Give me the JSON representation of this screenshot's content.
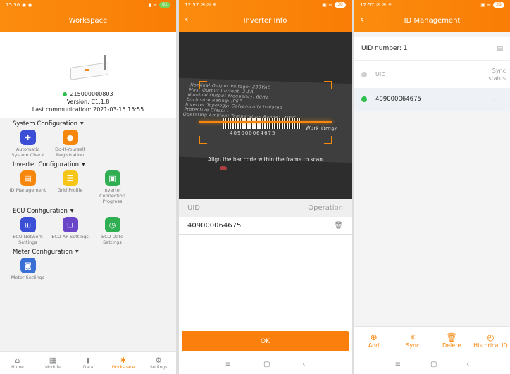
{
  "colors": {
    "accent": "#f7860c",
    "online": "#2fbf4e",
    "offline": "#cfcfcf"
  },
  "workspace": {
    "status": {
      "time": "15:56",
      "battery": "81"
    },
    "title": "Workspace",
    "device": {
      "id": "215000000803",
      "version": "Version: C1.1.8",
      "last_comm": "Last communication: 2021-03-15 15:55"
    },
    "sections": [
      {
        "title": "System Configuration",
        "items": [
          {
            "label": "Automatic System Check",
            "icon": "medkit-icon",
            "color": "#3a4ed6"
          },
          {
            "label": "Do-It-Yourself Registration",
            "icon": "person-icon",
            "color": "#f7860c"
          }
        ]
      },
      {
        "title": "Inverter Configuration",
        "items": [
          {
            "label": "ID Management",
            "icon": "id-card-icon",
            "color": "#f7860c"
          },
          {
            "label": "Grid Profile",
            "icon": "sliders-icon",
            "color": "#f5c518"
          },
          {
            "label": "Inverter Connection Progress",
            "icon": "inverter-icon",
            "color": "#2fae52"
          }
        ]
      },
      {
        "title": "ECU Configuration",
        "items": [
          {
            "label": "ECU Network Settings",
            "icon": "network-icon",
            "color": "#3a4ed6"
          },
          {
            "label": "ECU AP Settings",
            "icon": "ap-icon",
            "color": "#6a47c9"
          },
          {
            "label": "ECU Date Settings",
            "icon": "clock-icon",
            "color": "#2fae52"
          }
        ]
      },
      {
        "title": "Meter Configuration",
        "items": [
          {
            "label": "Meter Settings",
            "icon": "meter-icon",
            "color": "#3a6fd6"
          }
        ]
      }
    ],
    "tabs": [
      {
        "label": "Home",
        "icon": "home-icon"
      },
      {
        "label": "Module",
        "icon": "grid-icon"
      },
      {
        "label": "Data",
        "icon": "chart-icon"
      },
      {
        "label": "Workspace",
        "icon": "workspace-icon",
        "active": true
      },
      {
        "label": "Settings",
        "icon": "gear-icon"
      }
    ]
  },
  "inverter_info": {
    "status": {
      "time": "12:57",
      "battery": "38"
    },
    "title": "Inverter Info",
    "label_lines": [
      "Nominal Output Voltage: 230VAC",
      "Max. Output Current: 2.5A",
      "Nominal Output Frequency: 60Hz",
      "Enclosure Rating: IP67",
      "Inverter Topology: Galvanically Isolated",
      "Protective Class: I",
      "Operating Ambient Temperature Range: -40°C~"
    ],
    "label_fields": [
      "Identification Number",
      "Work Order"
    ],
    "label_code": "409000064675",
    "scan_hint": "Align the bar code within the frame to scan",
    "col_uid": "UID",
    "col_op": "Operation",
    "row_uid": "409000064675",
    "ok": "OK"
  },
  "id_management": {
    "status": {
      "time": "12:57",
      "battery": "38"
    },
    "title": "ID Management",
    "uid_number": "UID number: 1",
    "col_uid": "UID",
    "col_sync": "Sync status",
    "row_uid": "409000064675",
    "row_sync": "--",
    "actions": [
      {
        "label": "Add",
        "icon": "plus-circle-icon"
      },
      {
        "label": "Sync",
        "icon": "sync-icon"
      },
      {
        "label": "Delete",
        "icon": "trash-icon"
      },
      {
        "label": "Historical ID",
        "icon": "history-icon"
      }
    ]
  }
}
